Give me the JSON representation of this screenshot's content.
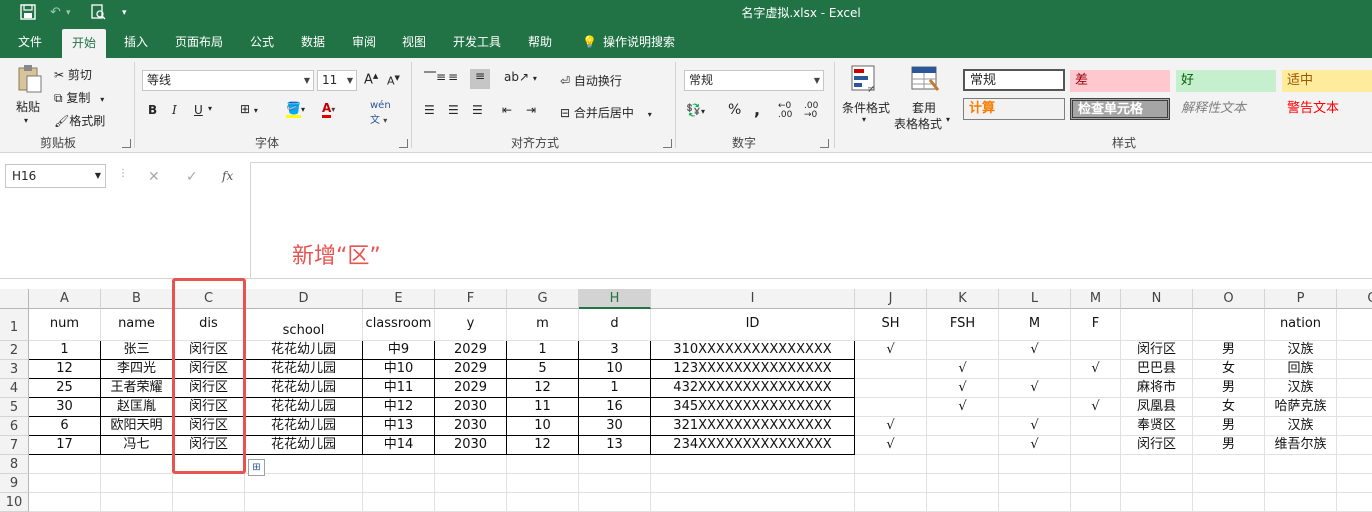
{
  "window": {
    "title": "名字虚拟.xlsx  -  Excel"
  },
  "tabs": [
    {
      "label": "文件",
      "active": false
    },
    {
      "label": "开始",
      "active": true
    },
    {
      "label": "插入",
      "active": false
    },
    {
      "label": "页面布局",
      "active": false
    },
    {
      "label": "公式",
      "active": false
    },
    {
      "label": "数据",
      "active": false
    },
    {
      "label": "审阅",
      "active": false
    },
    {
      "label": "视图",
      "active": false
    },
    {
      "label": "开发工具",
      "active": false
    },
    {
      "label": "帮助",
      "active": false
    }
  ],
  "tell_me": "操作说明搜索",
  "ribbon": {
    "clipboard": {
      "label": "剪贴板",
      "paste": "粘贴",
      "cut": "剪切",
      "copy": "复制",
      "format_painter": "格式刷"
    },
    "font": {
      "label": "字体",
      "font_name": "等线",
      "font_size": "11",
      "bold": "B",
      "italic": "I",
      "underline": "U"
    },
    "alignment": {
      "label": "对齐方式",
      "wrap": "自动换行",
      "merge": "合并后居中"
    },
    "number": {
      "label": "数字",
      "format": "常规",
      "percent": "%",
      "comma": ","
    },
    "styles": {
      "label": "样式",
      "conditional": "条件格式",
      "table_format_1": "套用",
      "table_format_2": "表格格式",
      "cells": [
        {
          "label": "常规"
        },
        {
          "label": "差"
        },
        {
          "label": "好"
        },
        {
          "label": "适中"
        },
        {
          "label": "计算"
        },
        {
          "label": "检查单元格"
        },
        {
          "label": "解释性文本"
        },
        {
          "label": "警告文本"
        }
      ]
    }
  },
  "formula_bar": {
    "name_box": "H16",
    "fx": "fx",
    "value": ""
  },
  "annotation": "新增“区”",
  "columns": [
    "A",
    "B",
    "C",
    "D",
    "E",
    "F",
    "G",
    "H",
    "I",
    "J",
    "K",
    "L",
    "M",
    "N",
    "O",
    "P",
    "Q"
  ],
  "row_numbers": [
    "1",
    "2",
    "3",
    "4",
    "5",
    "6",
    "7",
    "8",
    "9",
    "10"
  ],
  "header_row": [
    "num",
    "name",
    "dis",
    "school",
    "classroom",
    "y",
    "m",
    "d",
    "ID",
    "SH",
    "FSH",
    "M",
    "F",
    "",
    "",
    "nation",
    ""
  ],
  "rows": [
    [
      "1",
      "张三",
      "闵行区",
      "花花幼儿园",
      "中9",
      "2029",
      "1",
      "3",
      "310XXXXXXXXXXXXXXX",
      "√",
      "",
      "√",
      "",
      "闵行区",
      "男",
      "汉族",
      ""
    ],
    [
      "12",
      "李四光",
      "闵行区",
      "花花幼儿园",
      "中10",
      "2029",
      "5",
      "10",
      "123XXXXXXXXXXXXXXX",
      "",
      "√",
      "",
      "√",
      "巴巴县",
      "女",
      "回族",
      ""
    ],
    [
      "25",
      "王者荣耀",
      "闵行区",
      "花花幼儿园",
      "中11",
      "2029",
      "12",
      "1",
      "432XXXXXXXXXXXXXXX",
      "",
      "√",
      "√",
      "",
      "麻将市",
      "男",
      "汉族",
      ""
    ],
    [
      "30",
      "赵匡胤",
      "闵行区",
      "花花幼儿园",
      "中12",
      "2030",
      "11",
      "16",
      "345XXXXXXXXXXXXXXX",
      "",
      "√",
      "",
      "√",
      "凤凰县",
      "女",
      "哈萨克族",
      ""
    ],
    [
      "6",
      "欧阳天明",
      "闵行区",
      "花花幼儿园",
      "中13",
      "2030",
      "10",
      "30",
      "321XXXXXXXXXXXXXXX",
      "√",
      "",
      "√",
      "",
      "奉贤区",
      "男",
      "汉族",
      ""
    ],
    [
      "17",
      "冯七",
      "闵行区",
      "花花幼儿园",
      "中14",
      "2030",
      "12",
      "13",
      "234XXXXXXXXXXXXXXX",
      "√",
      "",
      "√",
      "",
      "闵行区",
      "男",
      "维吾尔族",
      ""
    ]
  ],
  "colors": {
    "excel_green": "#217346",
    "annotation_red": "#e8524f"
  }
}
